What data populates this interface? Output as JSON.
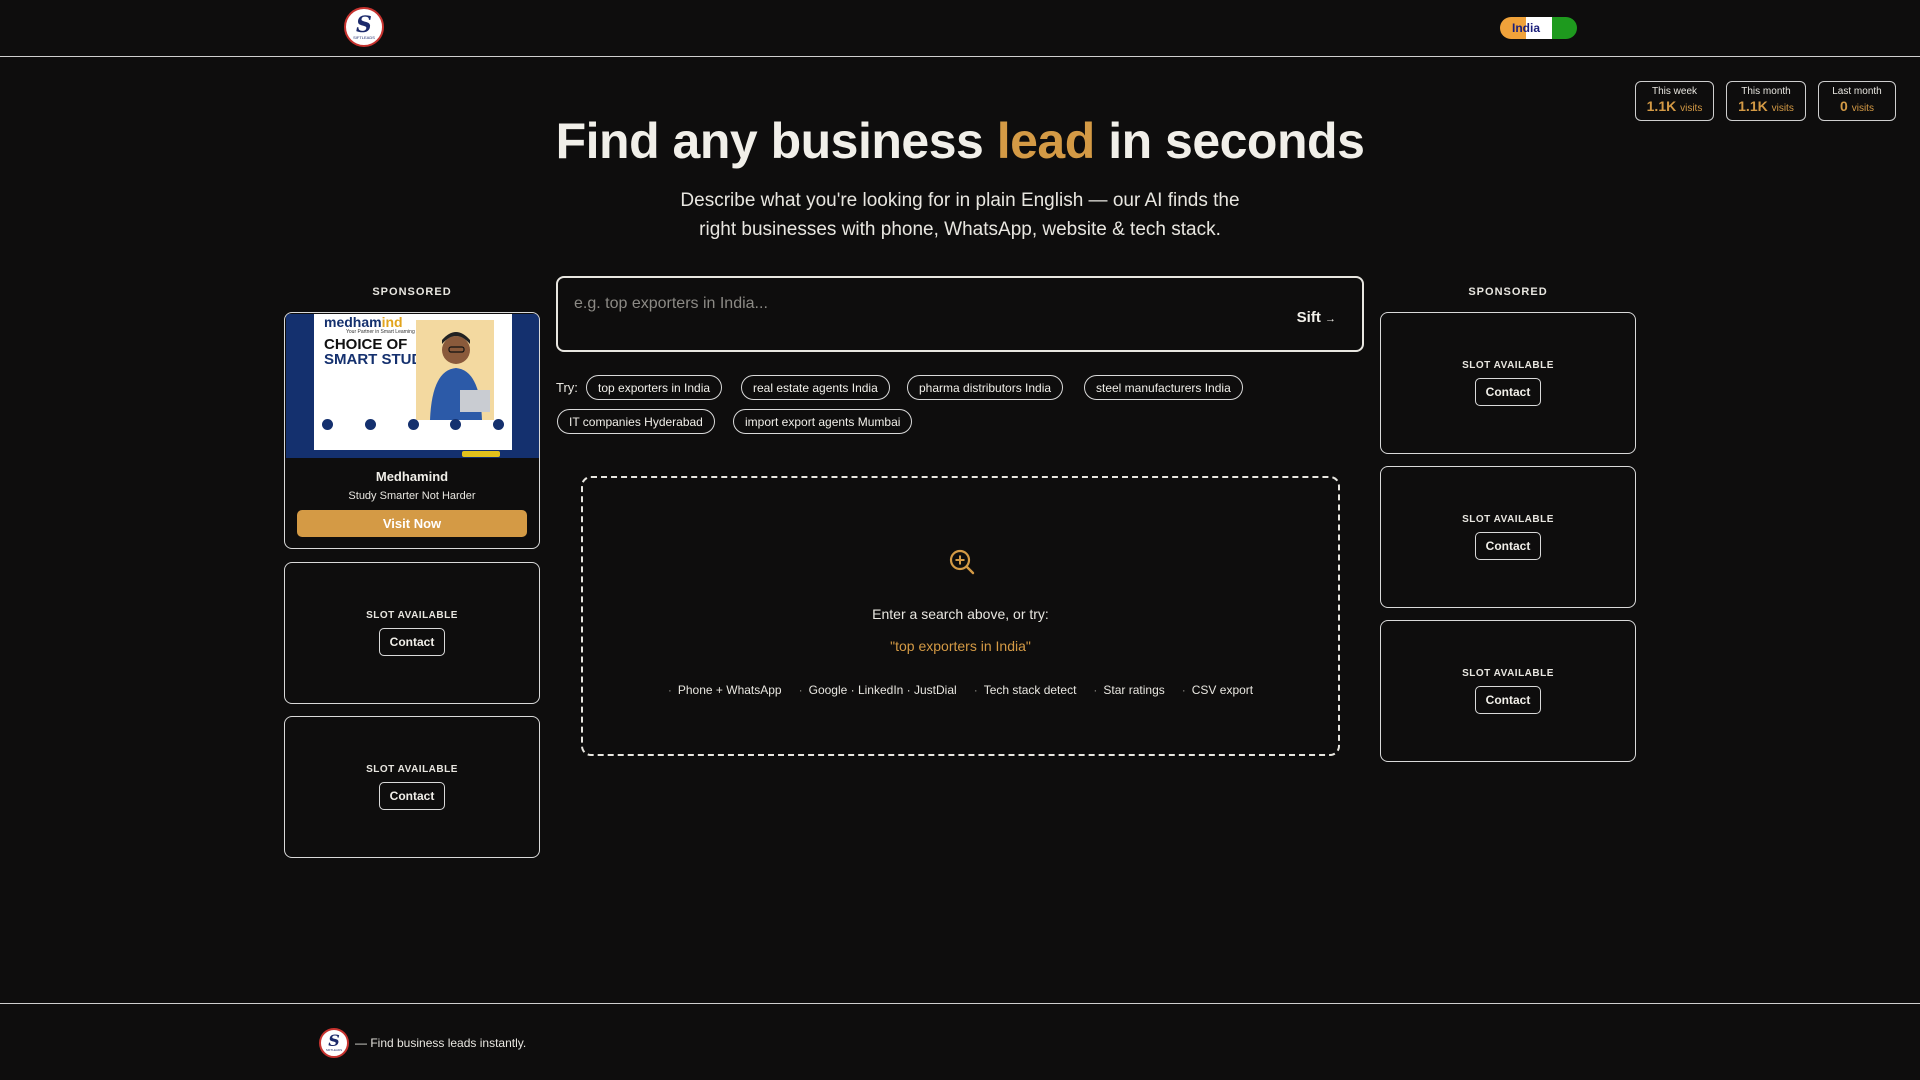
{
  "header": {
    "logo_letter": "S",
    "logo_sub": "SIFTLEADS",
    "country": "India"
  },
  "stats": [
    {
      "label": "This week",
      "value": "1.1K",
      "unit": "visits"
    },
    {
      "label": "This month",
      "value": "1.1K",
      "unit": "visits"
    },
    {
      "label": "Last month",
      "value": "0",
      "unit": "visits"
    }
  ],
  "hero": {
    "title_before": "Find any business ",
    "title_accent": "lead",
    "title_after": " in seconds",
    "subtitle": "Describe what you're looking for in plain English — our AI finds the right businesses with phone, WhatsApp, website & tech stack."
  },
  "search": {
    "placeholder": "e.g. top exporters in India...",
    "button": "Sift",
    "button_arrow": "→"
  },
  "try": {
    "label": "Try:",
    "chips": [
      "top exporters in India",
      "real estate agents India",
      "pharma distributors India",
      "steel manufacturers India",
      "IT companies Hyderabad",
      "import export agents Mumbai"
    ]
  },
  "empty_state": {
    "message": "Enter a search above, or try:",
    "example": "\"top exporters in India\"",
    "features": [
      "Phone + WhatsApp",
      "Google · LinkedIn · JustDial",
      "Tech stack detect",
      "Star ratings",
      "CSV export"
    ]
  },
  "sponsored": {
    "label": "SPONSORED",
    "ad": {
      "image_brand_1": "medham",
      "image_brand_2": "ind",
      "image_tagline": "Your Partner in Smart Learning",
      "image_head_1": "CHOICE OF",
      "image_head_2": "SMART STUDENT",
      "name": "Medhamind",
      "tagline": "Study Smarter Not Harder",
      "cta": "Visit Now"
    },
    "slot_label": "SLOT AVAILABLE",
    "slot_button": "Contact"
  },
  "footer": {
    "text": "— Find business leads instantly."
  },
  "colors": {
    "background": "#0e0d0d",
    "accent": "#d49a45",
    "border": "#d9d9d9"
  }
}
